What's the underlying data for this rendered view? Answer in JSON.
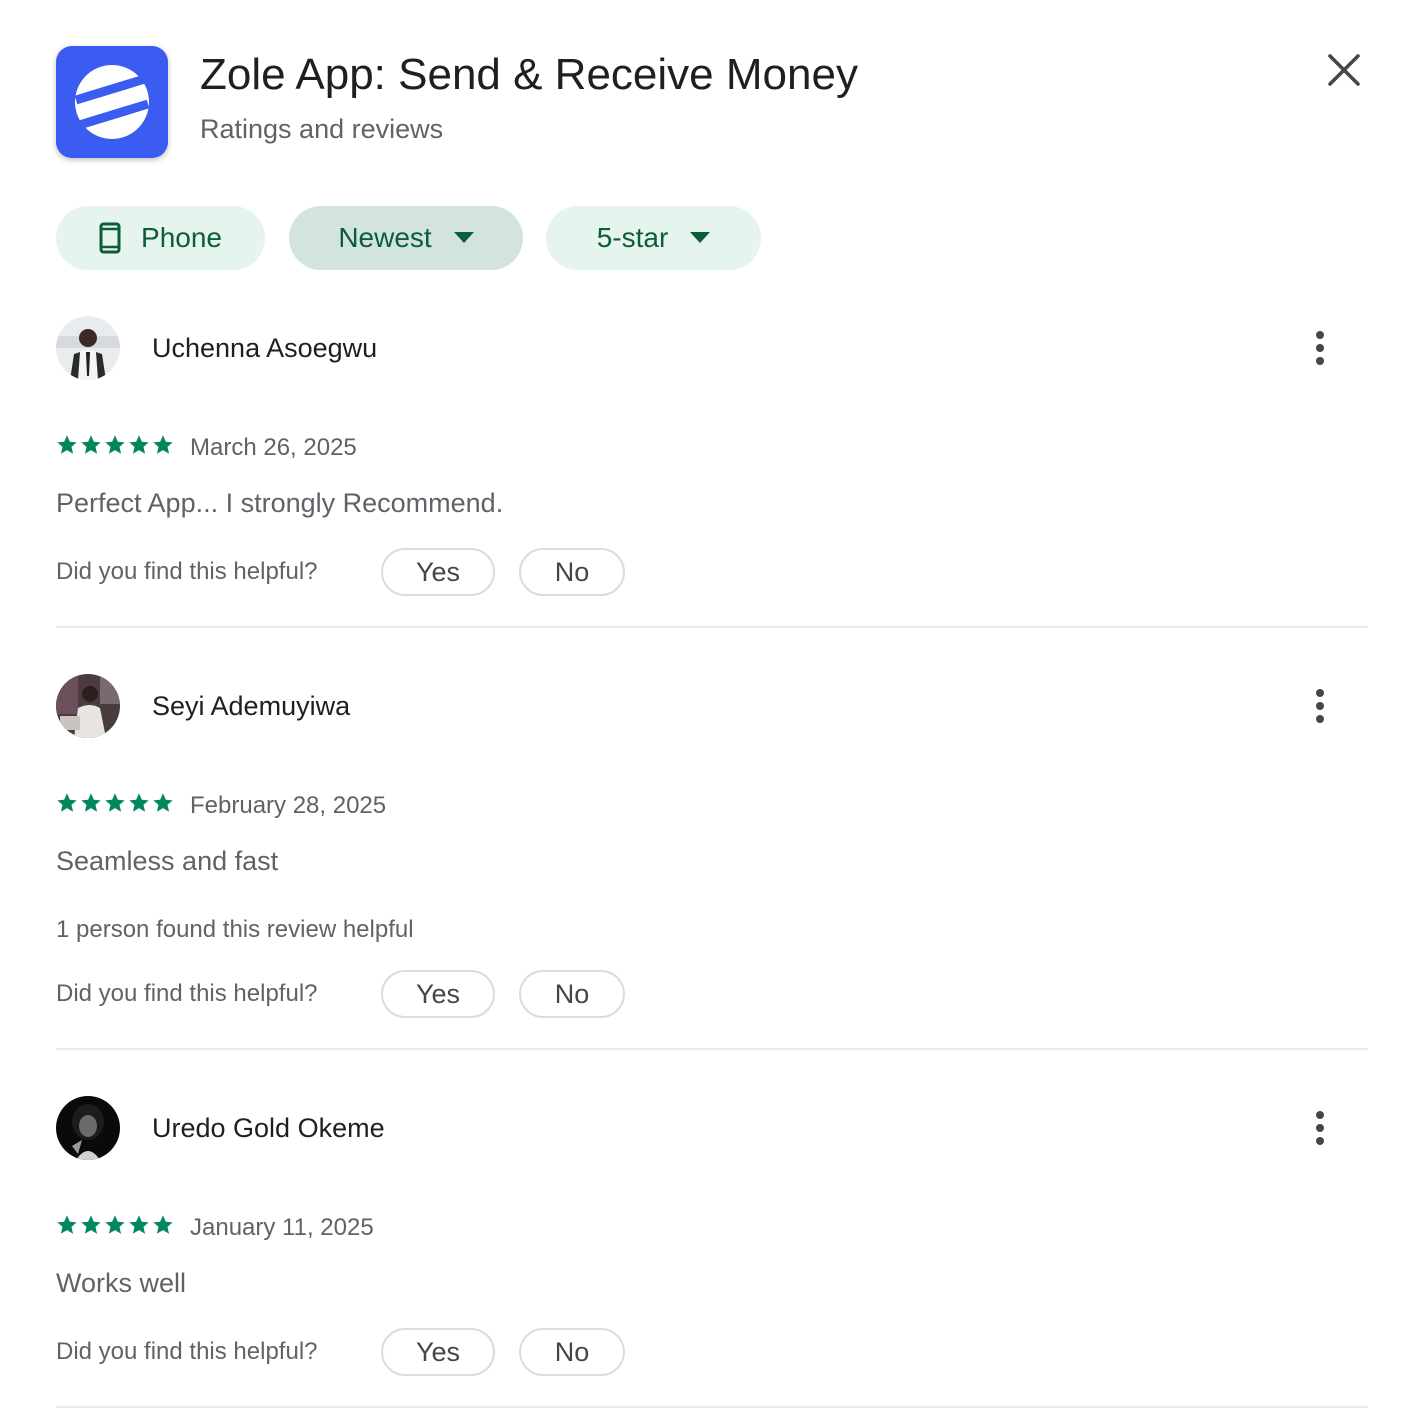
{
  "app": {
    "title": "Zole App: Send & Receive Money",
    "subtitle": "Ratings and reviews",
    "icon": "zole-logo-icon",
    "brand_color": "#3b5cf0"
  },
  "filters": {
    "device_label": "Phone",
    "sort_label": "Newest",
    "rating_label": "5-star"
  },
  "colors": {
    "chip_bg": "#e6f4ee",
    "chip_active_bg": "#d3e3de",
    "chip_text": "#0b5d3b",
    "star": "#01875f"
  },
  "helpful_prompt": "Did you find this helpful?",
  "yes_label": "Yes",
  "no_label": "No",
  "reviews": [
    {
      "name": "Uchenna Asoegwu",
      "rating": 5,
      "date": "March 26, 2025",
      "text": "Perfect App... I strongly Recommend.",
      "helpful_count_text": ""
    },
    {
      "name": "Seyi Ademuyiwa",
      "rating": 5,
      "date": "February 28, 2025",
      "text": "Seamless and fast",
      "helpful_count_text": "1 person found this review helpful"
    },
    {
      "name": "Uredo Gold Okeme",
      "rating": 5,
      "date": "January 11, 2025",
      "text": "Works well",
      "helpful_count_text": ""
    }
  ]
}
